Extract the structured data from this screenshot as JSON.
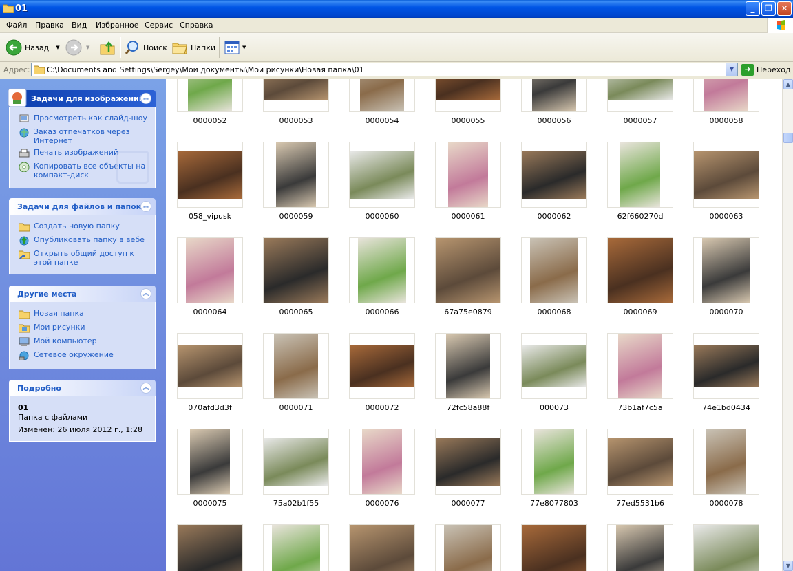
{
  "window": {
    "title": "01",
    "btn_min": "_",
    "btn_max": "❐",
    "btn_close": "✕"
  },
  "menu": [
    "Файл",
    "Правка",
    "Вид",
    "Избранное",
    "Сервис",
    "Справка"
  ],
  "toolbar": {
    "back": "Назад",
    "search": "Поиск",
    "folders": "Папки"
  },
  "address": {
    "label": "Адрес:",
    "path": "C:\\Documents and Settings\\Sergey\\Мои документы\\Мои рисунки\\Новая папка\\01",
    "go": "Переход"
  },
  "panels": {
    "image_tasks": {
      "title": "Задачи для изображений",
      "items": [
        "Просмотреть как слайд-шоу",
        "Заказ отпечатков через Интернет",
        "Печать изображений",
        "Копировать все объекты на компакт-диск"
      ]
    },
    "file_tasks": {
      "title": "Задачи для файлов и папок",
      "items": [
        "Создать новую папку",
        "Опубликовать папку в вебе",
        "Открыть общий доступ к этой папке"
      ]
    },
    "other_places": {
      "title": "Другие места",
      "items": [
        "Новая папка",
        "Мои рисунки",
        "Мой компьютер",
        "Сетевое окружение"
      ]
    },
    "details": {
      "title": "Подробно",
      "name": "01",
      "type": "Папка с файлами",
      "modified": "Изменен: 26 июля 2012 г., 1:28"
    }
  },
  "files": [
    [
      "0000052",
      "0000053",
      "0000054",
      "0000055",
      "0000056",
      "0000057",
      "0000058"
    ],
    [
      "058_vipusk",
      "0000059",
      "0000060",
      "0000061",
      "0000062",
      "62f660270d",
      "0000063"
    ],
    [
      "0000064",
      "0000065",
      "0000066",
      "67a75e0879",
      "0000068",
      "0000069",
      "0000070"
    ],
    [
      "070afd3d3f",
      "0000071",
      "0000072",
      "72fc58a88f",
      "000073",
      "73b1af7c5a",
      "74e1bd0434"
    ],
    [
      "0000075",
      "75a02b1f55",
      "0000076",
      "0000077",
      "77e8077803",
      "77ed5531b6",
      "0000078"
    ],
    [
      "",
      "",
      "",
      "",
      "",
      "",
      ""
    ]
  ],
  "colors": {
    "title_bar": "#0055e5",
    "task_pane": "#6375d6",
    "link": "#215dc6"
  }
}
